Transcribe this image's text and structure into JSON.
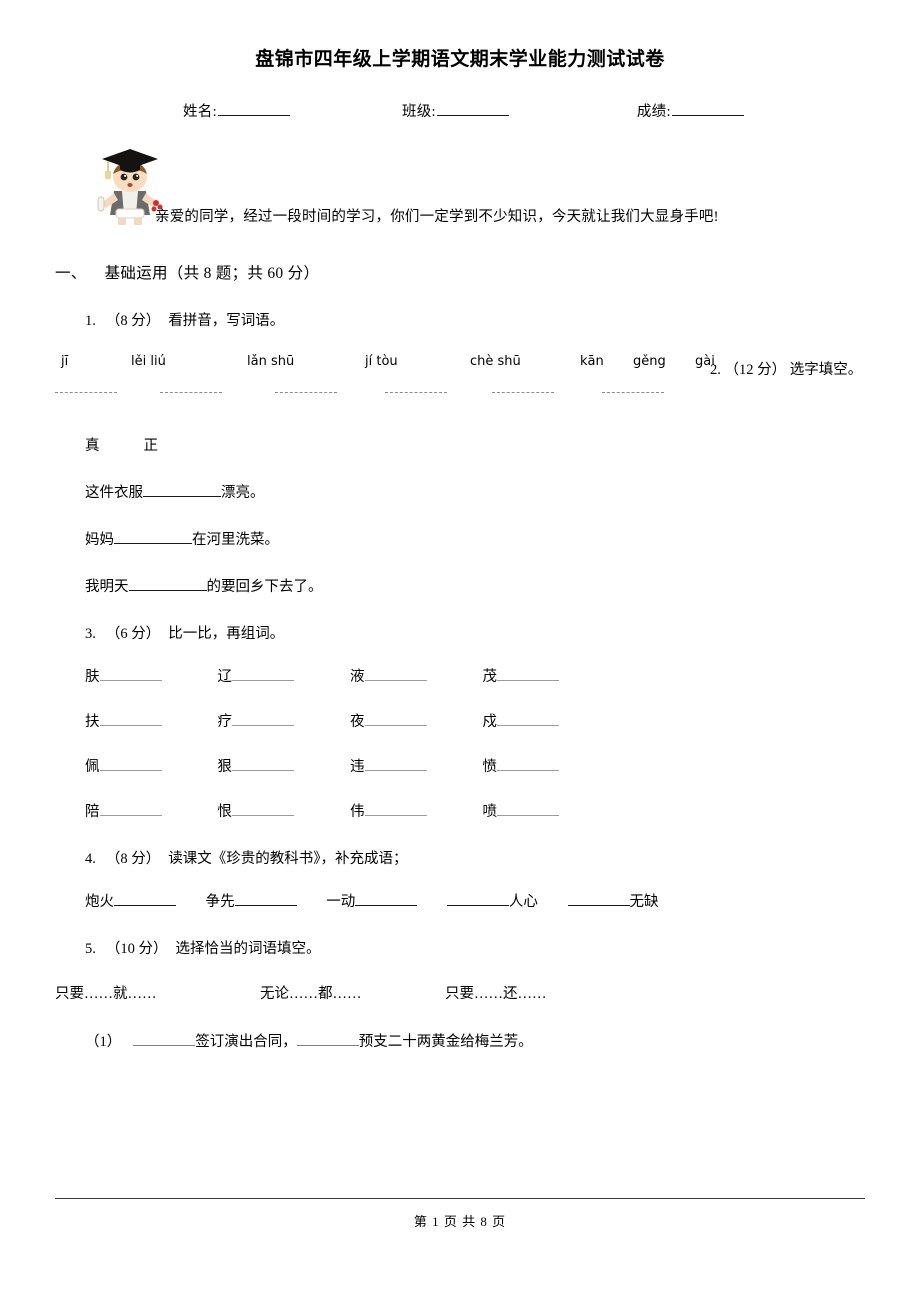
{
  "document": {
    "title": "盘锦市四年级上学期语文期末学业能力测试试卷",
    "identity_fields": [
      {
        "label": "姓名:"
      },
      {
        "label": "班级:"
      },
      {
        "label": "成绩:"
      }
    ],
    "greeting": "亲爱的同学，经过一段时间的学习，你们一定学到不少知识，今天就让我们大显身手吧!",
    "mascot_alt": "graduate-baby-mascot"
  },
  "section": {
    "number": "一、",
    "title": "基础运用（共 8 题；共 60 分）"
  },
  "questions": [
    {
      "index": "1.",
      "score": "（8 分）",
      "prompt": "看拼音，写词语。",
      "pinyin": [
        "jī",
        "lěi liú",
        "lǎn shū",
        "jí tòu",
        "chè shū",
        "kān",
        "gěng",
        "gài"
      ]
    },
    {
      "index": "2.",
      "score": "（12 分）",
      "prompt": "选字填空。",
      "choice_chars": [
        "真",
        "正"
      ],
      "sentences": [
        {
          "before": "这件衣服",
          "after": "漂亮。"
        },
        {
          "before": "妈妈",
          "after": "在河里洗菜。"
        },
        {
          "before": "我明天",
          "after": "的要回乡下去了。"
        }
      ]
    },
    {
      "index": "3.",
      "score": "（6 分）",
      "prompt": "比一比，再组词。",
      "grid": [
        [
          "肤",
          "辽",
          "液",
          "茂"
        ],
        [
          "扶",
          "疗",
          "夜",
          "戍"
        ],
        [
          "佩",
          "狠",
          "违",
          "愤"
        ],
        [
          "陪",
          "恨",
          "伟",
          "喷"
        ]
      ]
    },
    {
      "index": "4.",
      "score": "（8 分）",
      "prompt": "读课文《珍贵的教科书》，补充成语；",
      "idioms": [
        {
          "before": "炮火",
          "after": ""
        },
        {
          "before": "争先",
          "after": ""
        },
        {
          "before": "一动",
          "after": ""
        },
        {
          "before": "",
          "after": "人心"
        },
        {
          "before": "",
          "after": "无缺"
        }
      ]
    },
    {
      "index": "5.",
      "score": "（10 分）",
      "prompt": "选择恰当的词语填空。",
      "options": [
        "只要……就……",
        "无论……都……",
        "只要……还……"
      ],
      "sub_items": [
        {
          "label": "（1）",
          "part1": "签订演出合同，",
          "part2": "预支二十两黄金给梅兰芳。"
        }
      ]
    }
  ],
  "footer": {
    "page_text": "第 1 页 共 8 页"
  }
}
